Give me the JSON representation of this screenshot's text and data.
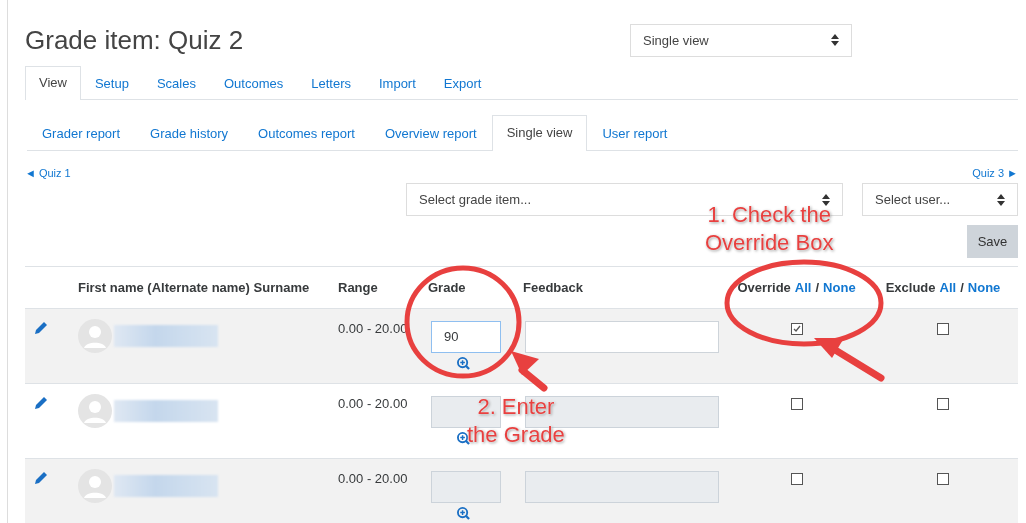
{
  "title": "Grade item: Quiz 2",
  "report_select": {
    "value": "Single view"
  },
  "tabs": [
    {
      "label": "View",
      "selected": true
    },
    {
      "label": "Setup",
      "selected": false
    },
    {
      "label": "Scales",
      "selected": false
    },
    {
      "label": "Outcomes",
      "selected": false
    },
    {
      "label": "Letters",
      "selected": false
    },
    {
      "label": "Import",
      "selected": false
    },
    {
      "label": "Export",
      "selected": false
    }
  ],
  "subtabs": [
    {
      "label": "Grader report",
      "selected": false
    },
    {
      "label": "Grade history",
      "selected": false
    },
    {
      "label": "Outcomes report",
      "selected": false
    },
    {
      "label": "Overview report",
      "selected": false
    },
    {
      "label": "Single view",
      "selected": true
    },
    {
      "label": "User report",
      "selected": false
    }
  ],
  "prev_link": "◄ Quiz 1",
  "next_link": "Quiz 3 ►",
  "grade_item_select": {
    "placeholder": "Select grade item..."
  },
  "user_select": {
    "placeholder": "Select user..."
  },
  "save_button": "Save",
  "columns": [
    {
      "label": "First name (Alternate name) Surname"
    },
    {
      "label": "Range"
    },
    {
      "label": "Grade"
    },
    {
      "label": "Feedback"
    },
    {
      "label": "Override",
      "all": "All",
      "separator": "/",
      "none": "None"
    },
    {
      "label": "Exclude",
      "all": "All",
      "separator": "/",
      "none": "None"
    }
  ],
  "rows": [
    {
      "range": "0.00 - 20.00",
      "grade": "90",
      "editable": true,
      "override": true,
      "exclude": false
    },
    {
      "range": "0.00 - 20.00",
      "editable": false,
      "override": false,
      "exclude": false
    },
    {
      "range": "0.00 - 20.00",
      "editable": false,
      "override": false,
      "exclude": false
    }
  ],
  "annotations": [
    {
      "text": "1. Check the\nOverride Box"
    },
    {
      "text": "2. Enter\nthe Grade"
    }
  ]
}
